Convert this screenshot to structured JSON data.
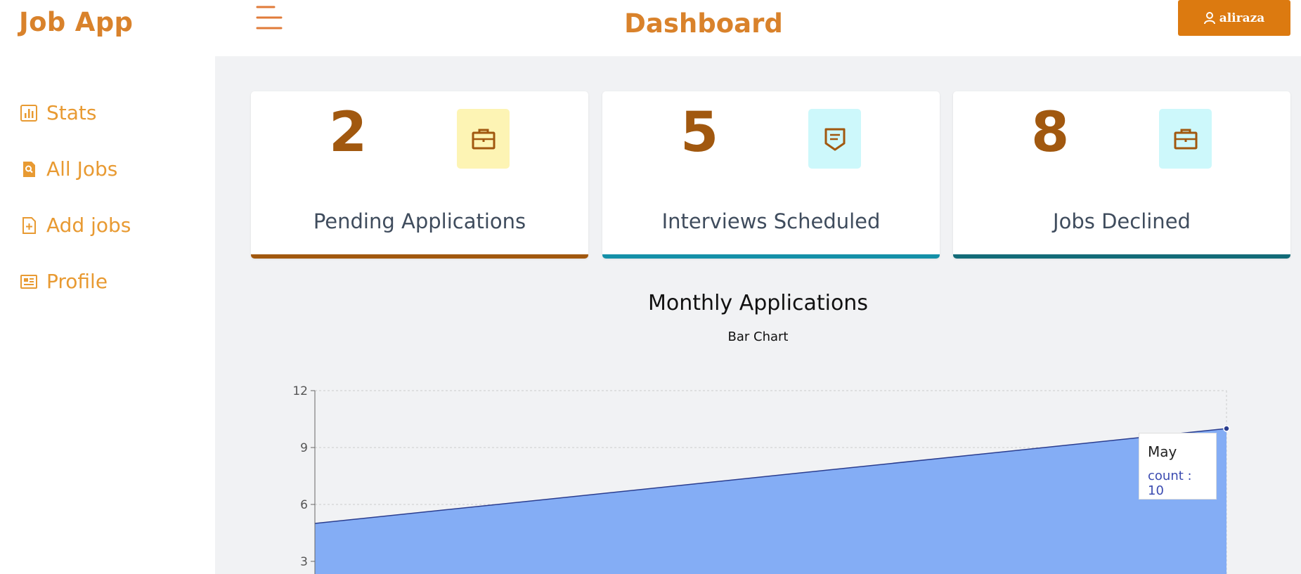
{
  "app": {
    "logo": "Job App",
    "page_title": "Dashboard",
    "user_name": "aliraza"
  },
  "sidebar": {
    "items": [
      {
        "label": "Stats",
        "icon": "bar-chart-icon"
      },
      {
        "label": "All Jobs",
        "icon": "search-document-icon"
      },
      {
        "label": "Add jobs",
        "icon": "add-document-icon"
      },
      {
        "label": "Profile",
        "icon": "id-card-icon"
      }
    ]
  },
  "stats": [
    {
      "count": "2",
      "label": "Pending Applications",
      "icon": "briefcase-icon",
      "color": "#a1580f",
      "icon_bg": "#fdf4b4",
      "bar_color": "#a1580f"
    },
    {
      "count": "5",
      "label": "Interviews Scheduled",
      "icon": "badge-icon",
      "color": "#a1580f",
      "icon_bg": "#cdf8fb",
      "bar_color": "#1590a8"
    },
    {
      "count": "8",
      "label": "Jobs Declined",
      "icon": "briefcase-icon",
      "color": "#a1580f",
      "icon_bg": "#cdf8fb",
      "bar_color": "#136b78"
    }
  ],
  "chart": {
    "title": "Monthly Applications",
    "subtitle": "Bar Chart"
  },
  "tooltip": {
    "label": "May",
    "value": "count : 10"
  },
  "chart_data": {
    "type": "area",
    "title": "Monthly Applications",
    "subtitle": "Bar Chart",
    "x": [
      "",
      "May"
    ],
    "series": [
      {
        "name": "count",
        "values": [
          5,
          10
        ]
      }
    ],
    "ylim": [
      0,
      12
    ],
    "yticks": [
      3,
      6,
      9,
      12
    ],
    "grid": true,
    "fill_color": "#84adf5",
    "line_color": "#2a3d8f"
  }
}
